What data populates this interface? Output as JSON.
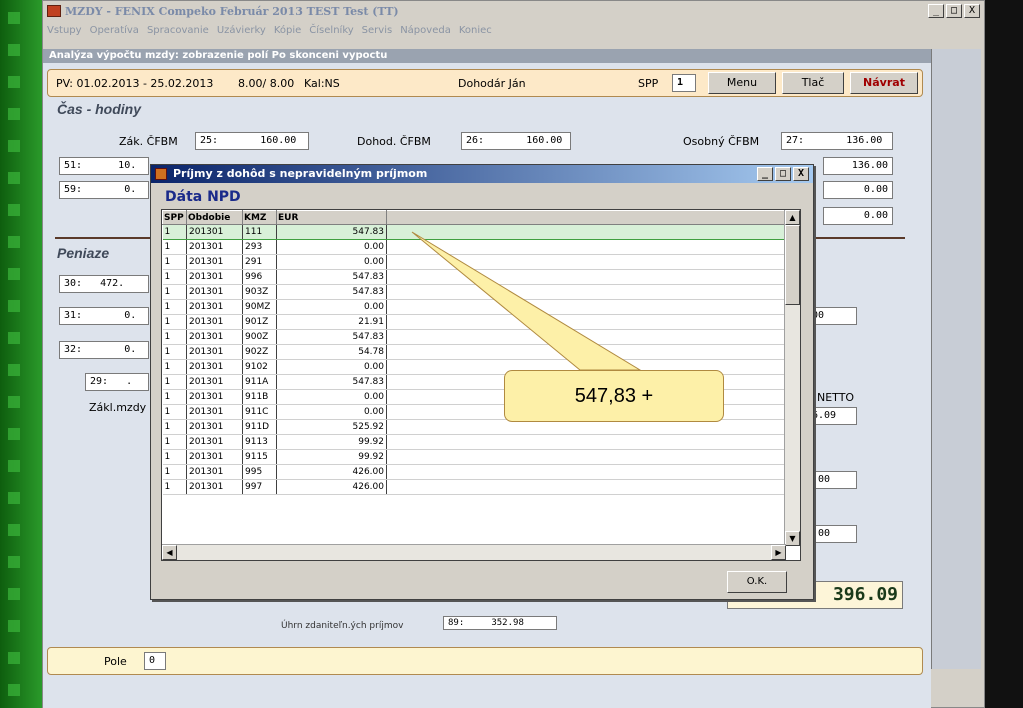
{
  "window": {
    "title": "MZDY - FENIX Compeko  Február 2013  TEST Test (TT)",
    "controls": [
      "_",
      "□",
      "X"
    ]
  },
  "menu": [
    "Vstupy",
    "Operatíva",
    "Spracovanie",
    "Uzávierky",
    "Kópie",
    "Číselníky",
    "Servis",
    "Nápoveda",
    "Koniec"
  ],
  "subheader": "Analýza výpočtu mzdy: zobrazenie polí Po skonceni vypoctu",
  "pvbar": {
    "period": "PV: 01.02.2013 - 25.02.2013",
    "hours": "8.00/ 8.00",
    "kal": "Kal:NS",
    "employee": "Dohodár Ján",
    "spp_label": "SPP",
    "spp_value": "1",
    "menu_btn": "Menu",
    "print_btn": "Tlač",
    "return_btn": "Návrat"
  },
  "time_section": {
    "heading": "Čas - hodiny",
    "zak_label": "Zák. ČFBM",
    "zak_value": "25:       160.00",
    "dohod_label": "Dohod. ČFBM",
    "dohod_value": "26:       160.00",
    "osobny_label": "Osobný ČFBM",
    "osobny_value": "27:       136.00",
    "row2_left": "51:      10.",
    "row2_right": "136.00",
    "row3_left": "59:       0.",
    "row3_right": "0.00",
    "row4_right": "0.00"
  },
  "money_section": {
    "heading": "Peniaze",
    "f30": "30:   472.",
    "f31": "31:       0.",
    "f32": "32:       0.",
    "f29": "29:   .",
    "zakl_label": "Zákl.mzdy",
    "r1": "00",
    "netto_label": "NETTO",
    "netto_value": "6.09",
    "r2": ".00",
    "r3": ".00",
    "total": "396.09",
    "hidden_label": "Úhrn zdaniteľn.ých príjmov",
    "hidden_value": "89:     352.98"
  },
  "pole": {
    "label": "Pole",
    "value": "0"
  },
  "dialog": {
    "title": "Príjmy z dohôd s nepravidelným príjmom",
    "subtitle": "Dáta NPD",
    "columns": [
      "SPP",
      "Obdobie",
      "KMZ",
      "EUR"
    ],
    "rows": [
      [
        "1",
        "201301",
        "111",
        "547.83"
      ],
      [
        "1",
        "201301",
        "293",
        "0.00"
      ],
      [
        "1",
        "201301",
        "291",
        "0.00"
      ],
      [
        "1",
        "201301",
        "996",
        "547.83"
      ],
      [
        "1",
        "201301",
        "903Z",
        "547.83"
      ],
      [
        "1",
        "201301",
        "90MZ",
        "0.00"
      ],
      [
        "1",
        "201301",
        "901Z",
        "21.91"
      ],
      [
        "1",
        "201301",
        "900Z",
        "547.83"
      ],
      [
        "1",
        "201301",
        "902Z",
        "54.78"
      ],
      [
        "1",
        "201301",
        "9102",
        "0.00"
      ],
      [
        "1",
        "201301",
        "911A",
        "547.83"
      ],
      [
        "1",
        "201301",
        "911B",
        "0.00"
      ],
      [
        "1",
        "201301",
        "911C",
        "0.00"
      ],
      [
        "1",
        "201301",
        "911D",
        "525.92"
      ],
      [
        "1",
        "201301",
        "9113",
        "99.92"
      ],
      [
        "1",
        "201301",
        "9115",
        "99.92"
      ],
      [
        "1",
        "201301",
        "995",
        "426.00"
      ],
      [
        "1",
        "201301",
        "997",
        "426.00"
      ]
    ],
    "ok_btn": "O.K."
  },
  "callout": "547,83 +"
}
